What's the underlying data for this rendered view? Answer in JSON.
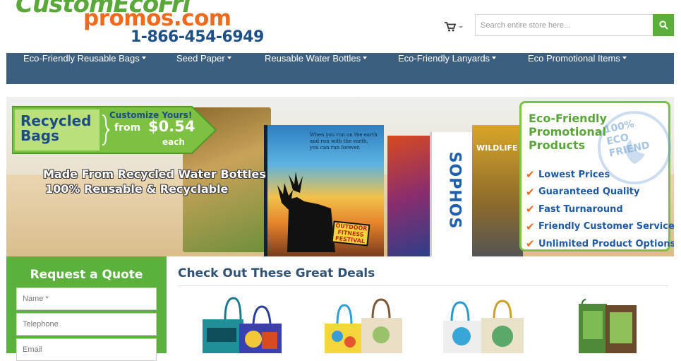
{
  "header": {
    "logo_top": "CustomEcoFri",
    "logo_middle": "promos.com",
    "logo_phone": "1-866-454-6949",
    "search_placeholder": "Search entire store here...",
    "colors": {
      "green": "#5cae3a",
      "orange": "#ef6a1f",
      "blue": "#1e4f86"
    }
  },
  "icons": {
    "cart": "shopping-cart-icon",
    "search": "search-icon",
    "caret": "caret-down-icon"
  },
  "nav": {
    "background": "#3c5f80",
    "items": [
      {
        "label": "Eco-Friendly Reusable Bags"
      },
      {
        "label": "Seed Paper"
      },
      {
        "label": "Reusable Water Bottles"
      },
      {
        "label": "Eco-Friendly Lanyards"
      },
      {
        "label": "Eco Promotional Items"
      }
    ]
  },
  "banner": {
    "tag_title": "Recycled Bags",
    "tag_customize": "Customize Yours!",
    "tag_from": "from",
    "tag_price": "$0.54",
    "tag_each": "each",
    "line1": "Made From Recycled Water Bottles",
    "line2": "100% Reusable & Recyclable",
    "panel_title": "Eco-Friendly Promotional Products",
    "panel_stamp": "100% ECO FRIEND",
    "benefits": [
      "Lowest Prices",
      "Guaranteed Quality",
      "Fast Turnaround",
      "Friendly Customer Service",
      "Unlimited Product Options"
    ],
    "bag_prints": [
      "When you run on the earth and run with the earth, you can run forever.",
      "OUTDOOR FITNESS FESTIVAL",
      "SOPHOS",
      "WILDLIFE"
    ]
  },
  "quote": {
    "title": "Request a Quote",
    "fields": [
      {
        "placeholder": "Name *"
      },
      {
        "placeholder": "Telephone"
      },
      {
        "placeholder": "Email"
      }
    ]
  },
  "deals": {
    "title": "Check Out These Great Deals",
    "products": [
      {
        "name": "product-bag-1"
      },
      {
        "name": "product-bag-2"
      },
      {
        "name": "product-bag-3"
      },
      {
        "name": "product-bag-4"
      }
    ]
  }
}
